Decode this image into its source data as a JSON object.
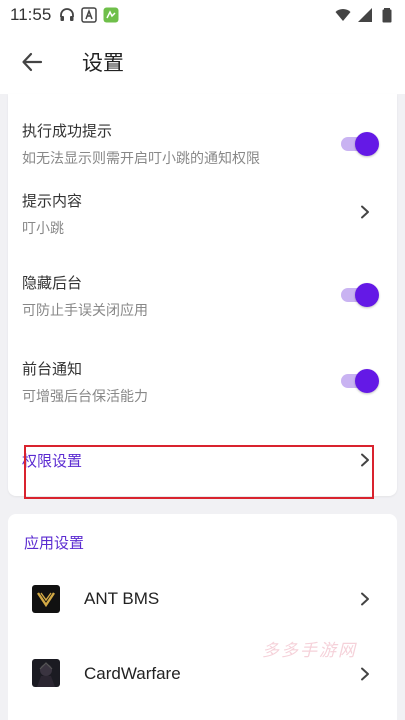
{
  "status_bar": {
    "time": "11:55",
    "left_icons": [
      "headset-icon",
      "a-letter-icon",
      "notification-app-icon"
    ],
    "right_icons": [
      "wifi-icon",
      "signal-icon",
      "battery-icon"
    ]
  },
  "app_bar": {
    "title": "设置",
    "back_icon": "arrow-left-icon"
  },
  "settings": {
    "exec_success": {
      "title": "执行成功提示",
      "subtitle": "如无法显示则需开启叮小跳的通知权限",
      "enabled": true
    },
    "prompt_content": {
      "title": "提示内容",
      "subtitle": "叮小跳"
    },
    "hide_background": {
      "title": "隐藏后台",
      "subtitle": "可防止手误关闭应用",
      "enabled": true
    },
    "foreground_notify": {
      "title": "前台通知",
      "subtitle": "可增强后台保活能力",
      "enabled": true
    },
    "permission": {
      "title": "权限设置"
    }
  },
  "app_settings": {
    "section_title": "应用设置",
    "apps": [
      {
        "name": "ANT BMS"
      },
      {
        "name": "CardWarfare"
      }
    ]
  },
  "watermark": "多多手游网",
  "colors": {
    "accent": "#6419e6",
    "toggle_track": "#c9b3f2",
    "section_title": "#5b2bd1",
    "highlight": "#d9232e"
  }
}
